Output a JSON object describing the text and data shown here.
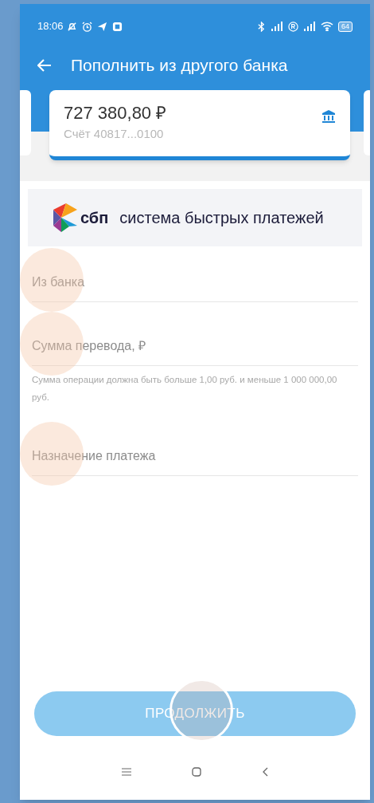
{
  "status_bar": {
    "time": "18:06",
    "battery": "64"
  },
  "header": {
    "title": "Пополнить из другого банка"
  },
  "account_card": {
    "amount": "727 380,80 ₽",
    "account": "Счёт 40817...0100"
  },
  "sbp_banner": {
    "logo_text": "сбп",
    "tagline": "система быстрых платежей"
  },
  "fields": [
    {
      "placeholder": "Из банка",
      "touch_marker": true
    },
    {
      "placeholder": "Сумма перевода, ₽",
      "touch_marker": true,
      "hint": "Сумма операции должна быть больше 1,00 руб. и меньше 1 000 000,00 руб."
    },
    {
      "placeholder": "Назначение платежа",
      "touch_marker": true
    }
  ],
  "button": {
    "label": "ПРОДОЛЖИТЬ",
    "disabled": true,
    "touch_marker": true
  }
}
